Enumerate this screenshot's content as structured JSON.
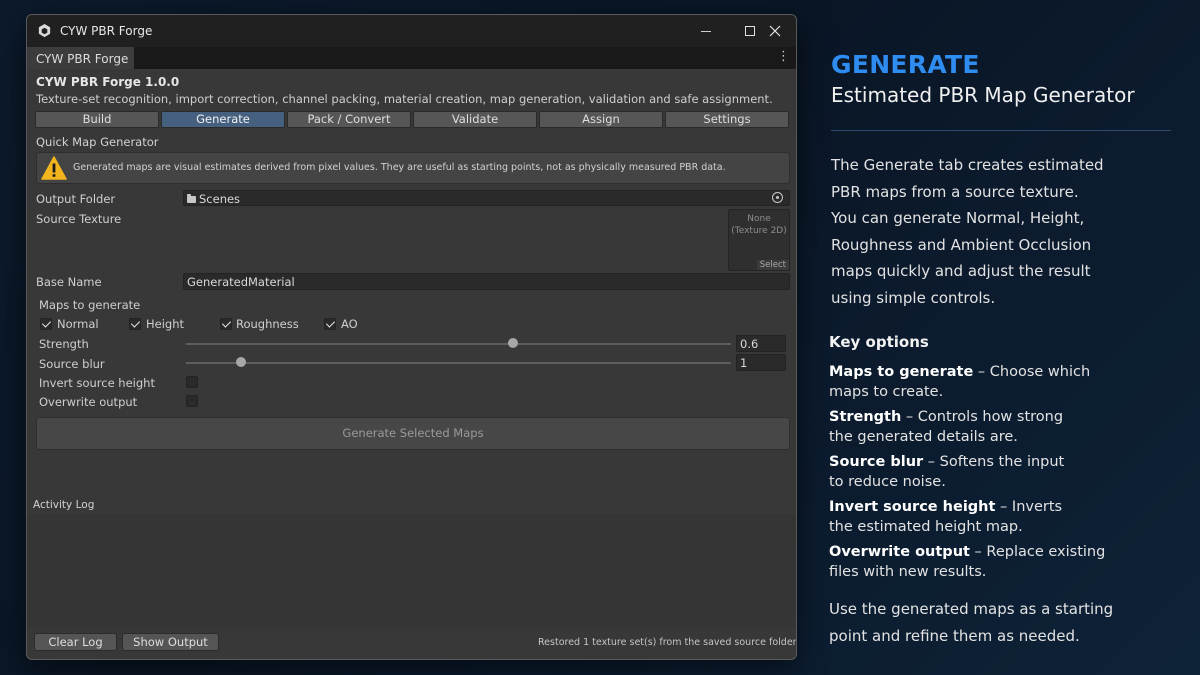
{
  "window": {
    "title": "CYW PBR Forge",
    "doc_tab": "CYW PBR Forge",
    "app_name": "CYW PBR Forge 1.0.0",
    "description": "Texture-set recognition, import correction, channel packing, material creation, map generation, validation and safe assignment."
  },
  "tabs": [
    {
      "label": "Build",
      "active": false
    },
    {
      "label": "Generate",
      "active": true
    },
    {
      "label": "Pack / Convert",
      "active": false
    },
    {
      "label": "Validate",
      "active": false
    },
    {
      "label": "Assign",
      "active": false
    },
    {
      "label": "Settings",
      "active": false
    }
  ],
  "generator": {
    "section_title": "Quick Map Generator",
    "warning": "Generated maps are visual estimates derived from pixel values. They are useful as starting points, not as physically measured PBR data.",
    "output_folder_label": "Output Folder",
    "output_folder_value": "Scenes",
    "source_texture_label": "Source Texture",
    "texture_none": "None",
    "texture_type": "(Texture 2D)",
    "texture_select": "Select",
    "base_name_label": "Base Name",
    "base_name_value": "GeneratedMaterial",
    "maps_label": "Maps to generate",
    "maps": [
      {
        "label": "Normal",
        "checked": true
      },
      {
        "label": "Height",
        "checked": true
      },
      {
        "label": "Roughness",
        "checked": true
      },
      {
        "label": "AO",
        "checked": true
      }
    ],
    "strength_label": "Strength",
    "strength_value": "0.6",
    "strength_fraction": 0.6,
    "blur_label": "Source blur",
    "blur_value": "1",
    "blur_fraction": 0.1,
    "invert_label": "Invert source height",
    "invert_checked": false,
    "overwrite_label": "Overwrite output",
    "overwrite_checked": false,
    "generate_button": "Generate Selected Maps"
  },
  "log": {
    "title": "Activity Log",
    "clear_button": "Clear Log",
    "show_button": "Show Output",
    "status": "Restored 1 texture set(s) from the saved source folder."
  },
  "panel": {
    "heading": "GENERATE",
    "subheading": "Estimated PBR Map Generator",
    "intro_lines": [
      "The Generate tab creates estimated",
      "PBR maps from a source texture.",
      "You can generate Normal, Height,",
      "Roughness and Ambient Occlusion",
      "maps quickly and adjust the result",
      "using simple controls."
    ],
    "key_options_title": "Key options",
    "options": [
      {
        "name": "Maps to generate",
        "line1": " – Choose which",
        "line2": "maps to create."
      },
      {
        "name": "Strength",
        "line1": " – Controls how strong",
        "line2": "the generated details are."
      },
      {
        "name": "Source blur",
        "line1": " – Softens the input",
        "line2": "to reduce noise."
      },
      {
        "name": "Invert source height",
        "line1": " – Inverts",
        "line2": "the estimated height map."
      },
      {
        "name": "Overwrite output",
        "line1": " – Replace existing",
        "line2": "files with new results."
      }
    ],
    "outro_lines": [
      "Use the generated maps as a starting",
      "point and refine them as needed."
    ]
  },
  "colors": {
    "accent": "#2f8cf0",
    "active_tab": "#46607f",
    "warning_icon": "#f2b51d"
  }
}
